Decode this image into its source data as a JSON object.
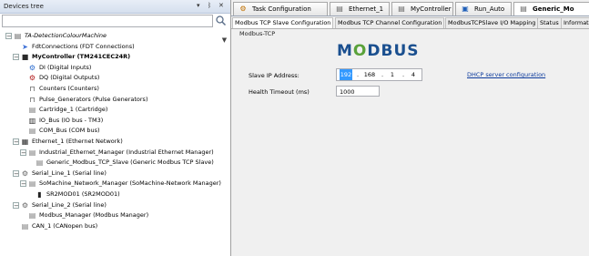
{
  "devices_tree": {
    "title": "Devices tree",
    "pin": "▾",
    "pin2": "ᛒ",
    "close": "✕",
    "tree": [
      {
        "label": "TA-DetectionColourMachine",
        "italic": true
      },
      {
        "label": "FdtConnections (FDT Connections)"
      },
      {
        "label": "MyController (TM241CEC24R)",
        "bold": true
      },
      {
        "label": "DI (Digital Inputs)"
      },
      {
        "label": "DQ (Digital Outputs)"
      },
      {
        "label": "Counters (Counters)"
      },
      {
        "label": "Pulse_Generators (Pulse Generators)"
      },
      {
        "label": "Cartridge_1 (Cartridge)"
      },
      {
        "label": "IO_Bus (IO bus - TM3)"
      },
      {
        "label": "COM_Bus (COM bus)"
      },
      {
        "label": "Ethernet_1 (Ethernet Network)"
      },
      {
        "label": "Industrial_Ethernet_Manager (Industrial Ethernet Manager)"
      },
      {
        "label": "Generic_Modbus_TCP_Slave (Generic Modbus TCP Slave)"
      },
      {
        "label": "Serial_Line_1 (Serial line)"
      },
      {
        "label": "SoMachine_Network_Manager (SoMachine-Network Manager)"
      },
      {
        "label": "SR2MOD01 (SR2MOD01)"
      },
      {
        "label": "Serial_Line_2 (Serial line)"
      },
      {
        "label": "Modbus_Manager (Modbus Manager)"
      },
      {
        "label": "CAN_1 (CANopen bus)"
      }
    ]
  },
  "editor_tabs": [
    {
      "label": "Task Configuration"
    },
    {
      "label": "Ethernet_1"
    },
    {
      "label": "MyController"
    },
    {
      "label": "Run_Auto"
    },
    {
      "label": "Generic_Mo"
    }
  ],
  "sub_tabs": [
    {
      "label": "Modbus TCP Slave Configuration"
    },
    {
      "label": "Modbus TCP Channel Configuration"
    },
    {
      "label": "ModbusTCPSlave I/O Mapping"
    },
    {
      "label": "Status"
    },
    {
      "label": "Information"
    }
  ],
  "config": {
    "group_title": "Modbus-TCP",
    "logo_text": "MODBUS",
    "slave_ip_label": "Slave IP Address:",
    "ip_octets": [
      "192",
      "168",
      "1",
      "4"
    ],
    "health_timeout_label": "Health Timeout (ms)",
    "health_timeout_value": "1000",
    "dhcp_link": "DHCP server configuration"
  }
}
